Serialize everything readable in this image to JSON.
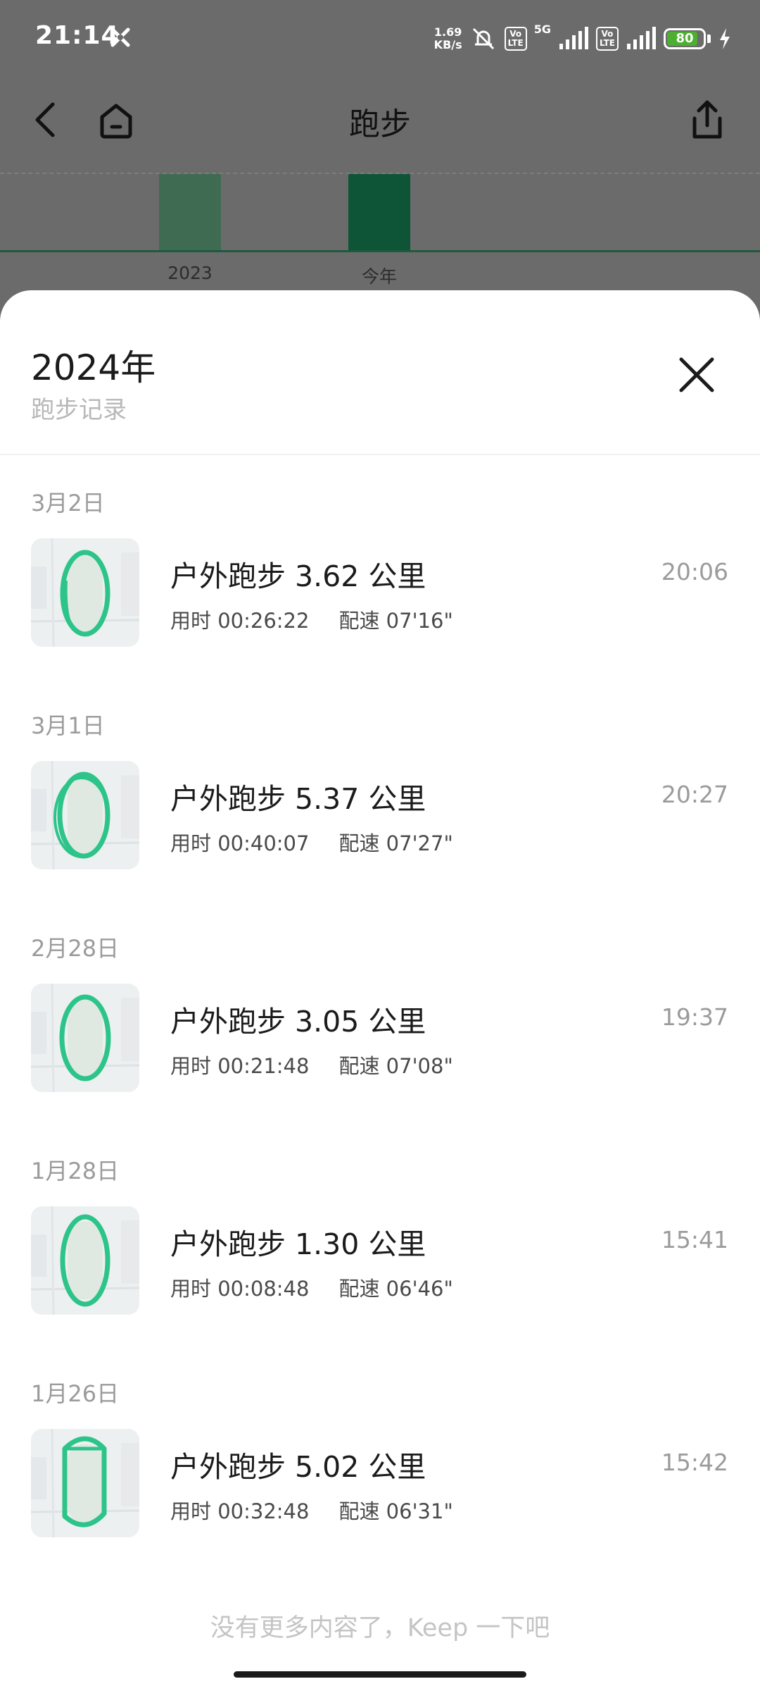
{
  "status_bar": {
    "time": "21:14",
    "net_speed_value": "1.69",
    "net_speed_unit": "KB/s",
    "volte1": "Vo\nLTE",
    "network_type": "5G",
    "volte2": "Vo\nLTE",
    "battery_level": "80",
    "icons": [
      "network-blocked-icon",
      "mute-icon",
      "signal-icon",
      "charging-icon"
    ]
  },
  "app_bar": {
    "title": "跑步",
    "icons": [
      "back-arrow-icon",
      "home-icon",
      "share-icon"
    ]
  },
  "chart": {
    "categories": [
      "2023",
      "今年"
    ],
    "colors": {
      "past": "#3e6b52",
      "current": "#0e5537"
    }
  },
  "sheet": {
    "title": "2024年",
    "subtitle": "跑步记录",
    "close_icon": "close-icon",
    "records": [
      {
        "date": "3月2日",
        "title": "户外跑步 3.62 公里",
        "duration": "用时 00:26:22",
        "pace": "配速 07'16\"",
        "time": "20:06"
      },
      {
        "date": "3月1日",
        "title": "户外跑步 5.37 公里",
        "duration": "用时 00:40:07",
        "pace": "配速 07'27\"",
        "time": "20:27"
      },
      {
        "date": "2月28日",
        "title": "户外跑步 3.05 公里",
        "duration": "用时 00:21:48",
        "pace": "配速 07'08\"",
        "time": "19:37"
      },
      {
        "date": "1月28日",
        "title": "户外跑步 1.30 公里",
        "duration": "用时 00:08:48",
        "pace": "配速 06'46\"",
        "time": "15:41"
      },
      {
        "date": "1月26日",
        "title": "户外跑步 5.02 公里",
        "duration": "用时 00:32:48",
        "pace": "配速 06'31\"",
        "time": "15:42"
      }
    ],
    "footer": "没有更多内容了，Keep 一下吧"
  },
  "colors": {
    "route": "#2dc48a",
    "accent_green": "#0e5537",
    "overlay": "#6b6b6b"
  }
}
